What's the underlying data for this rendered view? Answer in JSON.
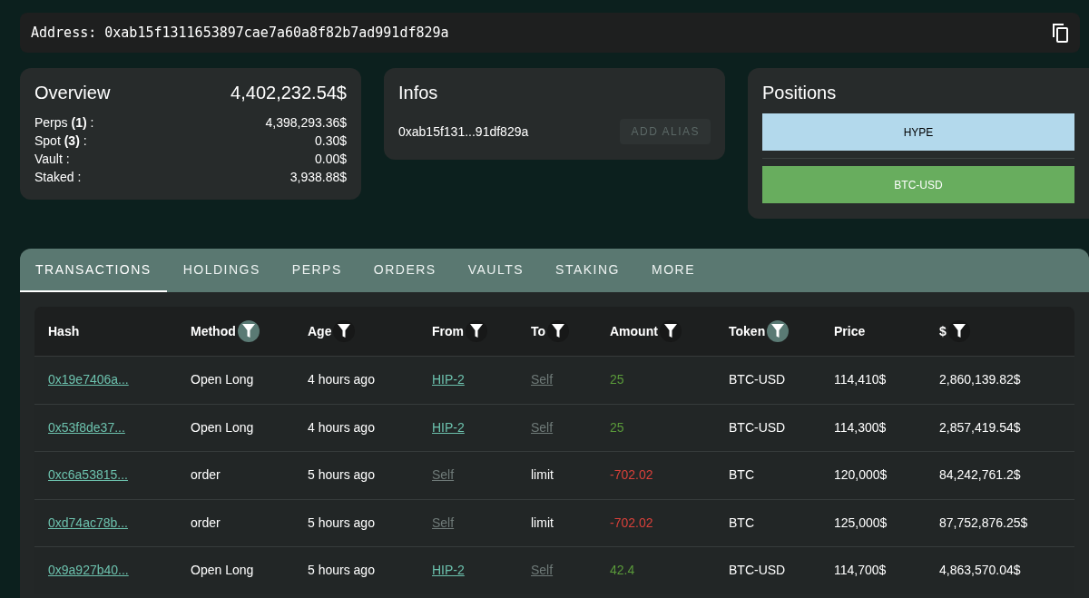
{
  "address": {
    "label": "Address:",
    "value": "0xab15f1311653897cae7a60a8f82b7ad991df829a"
  },
  "overview": {
    "title": "Overview",
    "total": "4,402,232.54$",
    "rows": [
      {
        "label": "Perps **(1)** :",
        "value": "4,398,293.36$"
      },
      {
        "label": "Spot **(3)** :",
        "value": "0.30$"
      },
      {
        "label": "Vault :",
        "value": "0.00$"
      },
      {
        "label": "Staked :",
        "value": "3,938.88$"
      }
    ]
  },
  "infos": {
    "title": "Infos",
    "short_address": "0xab15f131...91df829a",
    "button": {
      "label": "ADD ALIAS",
      "disabled": true
    }
  },
  "positions": {
    "title": "Positions",
    "items": [
      {
        "label": "HYPE",
        "color": "#b3d9ec"
      },
      {
        "label": "BTC-USD",
        "color": "#68ad5e"
      }
    ]
  },
  "tabs": [
    {
      "label": "TRANSACTIONS",
      "selected": true
    },
    {
      "label": "HOLDINGS",
      "selected": false
    },
    {
      "label": "PERPS",
      "selected": false
    },
    {
      "label": "ORDERS",
      "selected": false
    },
    {
      "label": "VAULTS",
      "selected": false
    },
    {
      "label": "STAKING",
      "selected": false
    },
    {
      "label": "MORE",
      "selected": false
    }
  ],
  "table": {
    "columns": [
      {
        "label": "Hash",
        "filter": false
      },
      {
        "label": "Method",
        "filter": true,
        "filter_active": true
      },
      {
        "label": "Age",
        "filter": true,
        "filter_active": false
      },
      {
        "label": "From",
        "filter": true,
        "filter_active": false
      },
      {
        "label": "To",
        "filter": true,
        "filter_active": false
      },
      {
        "label": "Amount",
        "filter": true,
        "filter_active": false
      },
      {
        "label": "Token",
        "filter": true,
        "filter_active": true
      },
      {
        "label": "Price",
        "filter": false
      },
      {
        "label": "$",
        "filter": true,
        "filter_active": false
      }
    ],
    "rows": [
      {
        "hash": "0x19e7406a...",
        "method": "Open Long",
        "age": "4 hours ago",
        "from": {
          "text": "HIP-2",
          "kind": "link"
        },
        "to": {
          "text": "Self",
          "kind": "self"
        },
        "amount": "25",
        "kind": "gain",
        "token": "BTC-USD",
        "price": "114,410$",
        "usd": "2,860,139.82$"
      },
      {
        "hash": "0x53f8de37...",
        "method": "Open Long",
        "age": "4 hours ago",
        "from": {
          "text": "HIP-2",
          "kind": "link"
        },
        "to": {
          "text": "Self",
          "kind": "self"
        },
        "amount": "25",
        "kind": "gain",
        "token": "BTC-USD",
        "price": "114,300$",
        "usd": "2,857,419.54$"
      },
      {
        "hash": "0xc6a53815...",
        "method": "order",
        "age": "5 hours ago",
        "from": {
          "text": "Self",
          "kind": "self"
        },
        "to": {
          "text": "limit",
          "kind": "text"
        },
        "amount": "-702.02",
        "kind": "loss",
        "token": "BTC",
        "price": "120,000$",
        "usd": "84,242,761.2$"
      },
      {
        "hash": "0xd74ac78b...",
        "method": "order",
        "age": "5 hours ago",
        "from": {
          "text": "Self",
          "kind": "self"
        },
        "to": {
          "text": "limit",
          "kind": "text"
        },
        "amount": "-702.02",
        "kind": "loss",
        "token": "BTC",
        "price": "125,000$",
        "usd": "87,752,876.25$"
      },
      {
        "hash": "0x9a927b40...",
        "method": "Open Long",
        "age": "5 hours ago",
        "from": {
          "text": "HIP-2",
          "kind": "link"
        },
        "to": {
          "text": "Self",
          "kind": "self"
        },
        "amount": "42.4",
        "kind": "gain",
        "token": "BTC-USD",
        "price": "114,700$",
        "usd": "4,863,570.04$"
      }
    ]
  }
}
